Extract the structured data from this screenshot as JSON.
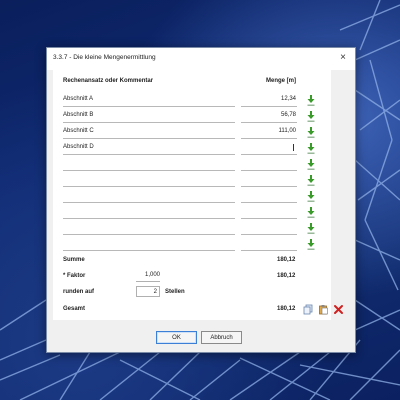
{
  "window": {
    "title": "3.3.7 - Die kleine Mengenermittlung",
    "close_glyph": "×"
  },
  "table": {
    "headers": {
      "formula": "Rechenansatz oder Kommentar",
      "quantity": "Menge [m]"
    },
    "rows": [
      {
        "formula": "Abschnitt A",
        "quantity": "12,34"
      },
      {
        "formula": "Abschnitt B",
        "quantity": "56,78"
      },
      {
        "formula": "Abschnitt C",
        "quantity": "111,00"
      },
      {
        "formula": "Abschnitt D",
        "quantity": ""
      },
      {
        "formula": "",
        "quantity": ""
      },
      {
        "formula": "",
        "quantity": ""
      },
      {
        "formula": "",
        "quantity": ""
      },
      {
        "formula": "",
        "quantity": ""
      },
      {
        "formula": "",
        "quantity": ""
      },
      {
        "formula": "",
        "quantity": ""
      }
    ],
    "row_icon": "green-download-arrow-icon"
  },
  "summary": {
    "sum_label": "Summe",
    "sum_value": "180,12",
    "factor_label": "* Faktor",
    "factor_value": "1,000",
    "factor_result": "180,12",
    "round_label": "runden auf",
    "round_value": "2",
    "round_unit": "Stellen",
    "total_label": "Gesamt",
    "total_value": "180,12"
  },
  "actions": {
    "icons": [
      "copy-icon",
      "paste-icon",
      "delete-icon"
    ]
  },
  "buttons": {
    "ok": "OK",
    "cancel": "Abbruch"
  },
  "colors": {
    "accent_green": "#3a9a2a",
    "delete_red": "#d02020",
    "focus_blue": "#3c7fd6"
  }
}
